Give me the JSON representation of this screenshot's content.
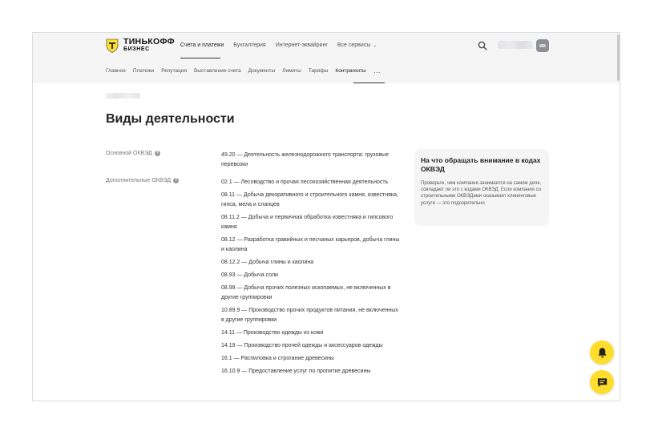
{
  "brand": {
    "name": "ТИНЬКОФФ",
    "sub": "БИЗНЕС"
  },
  "top_nav": [
    "Счета и платежи",
    "Бухгалтерия",
    "Интернет-эквайринг",
    "Все сервисы"
  ],
  "sub_nav": [
    "Главное",
    "Платежи",
    "Репутация",
    "Выставление счета",
    "Документы",
    "Лимиты",
    "Тарифы",
    "Контрагенты"
  ],
  "page_title": "Виды деятельности",
  "main_okved": {
    "label": "Основной ОКВЭД",
    "value": "49.20 — Деятельность железнодорожного транспорта: грузовые перевозки"
  },
  "additional_okved": {
    "label": "Дополнительные ОКВЭД",
    "items": [
      "02.1 — Лесоводство и прочая лесохозяйственная деятельность",
      "08.11 — Добыча декоративного и строительного камня, известняка, гипса, мела и сланцев",
      "08.11.2 — Добыча и первичная обработка известняка и гипсового камня",
      "08.12 — Разработка гравийных и песчаных карьеров, добыча глины и каолина",
      "08.12.2 — Добыча глины и каолина",
      "08.93 — Добыча соли",
      "08.99 — Добыча прочих полезных ископаемых, не включенных в другие группировки",
      "10.89.9 — Производство прочих продуктов питания, не включенных в другие группировки",
      "14.11 — Производство одежды из кожи",
      "14.19 — Производство прочей одежды и аксессуаров одежды",
      "16.1 — Распиловка и строгание древесины",
      "16.10.9 — Предоставление услуг по пропитке древесины"
    ]
  },
  "info_card": {
    "title": "На что обращать внимание в кодах ОКВЭД",
    "body": "Проверьте, чем компания занимается на самом деле, совпадает ли это с кодами ОКВЭД. Если компания со строительными ОКВЭДами оказывает клининговые услуги — это подозрительно"
  },
  "icons": [
    "logo-shield-icon",
    "search-icon",
    "chevron-down-icon",
    "more-icon",
    "question-icon",
    "bell-icon",
    "chat-icon"
  ],
  "colors": {
    "accent": "#ffdd2d",
    "header_bg": "#f5f5f6",
    "card_bg": "#f5f5f6"
  }
}
